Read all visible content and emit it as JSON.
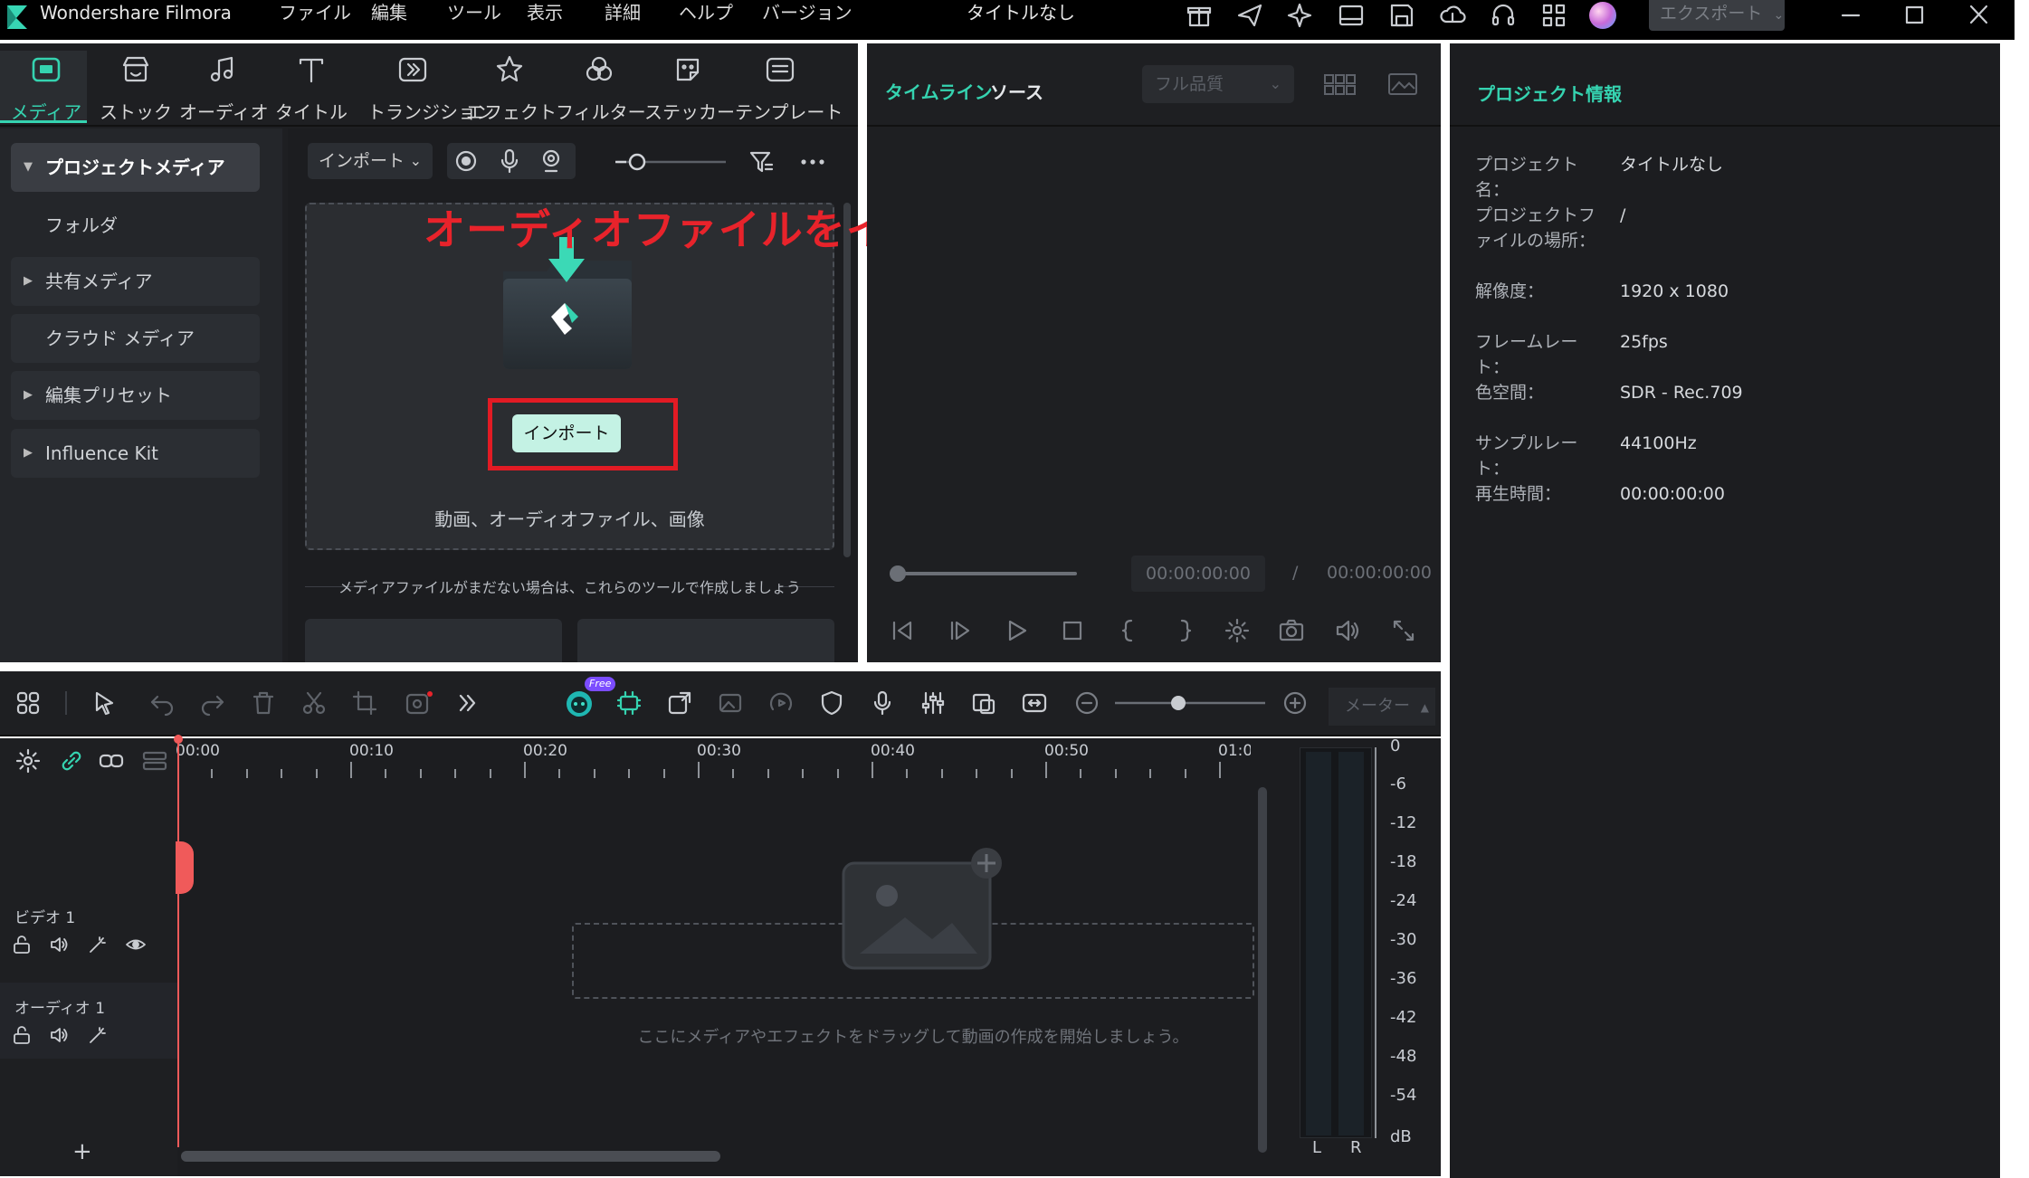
{
  "app": {
    "name": "Wondershare Filmora",
    "menu": [
      "ファイル",
      "編集",
      "ツール",
      "表示",
      "詳細",
      "ヘルプ",
      "バージョン"
    ],
    "project_title": "タイトルなし",
    "export_label": "エクスポート"
  },
  "toolbar": {
    "items": [
      {
        "label": "メディア",
        "icon": "media-icon"
      },
      {
        "label": "ストック",
        "icon": "stock-icon"
      },
      {
        "label": "オーディオ",
        "icon": "audio-icon"
      },
      {
        "label": "タイトル",
        "icon": "title-icon"
      },
      {
        "label": "トランジション",
        "icon": "transition-icon"
      },
      {
        "label": "エフェクト",
        "icon": "effect-icon"
      },
      {
        "label": "フィルター",
        "icon": "filter-icon"
      },
      {
        "label": "ステッカー",
        "icon": "sticker-icon"
      },
      {
        "label": "テンプレート",
        "icon": "template-icon"
      }
    ]
  },
  "sidebar": {
    "items": [
      {
        "label": "プロジェクトメディア"
      },
      {
        "label": "フォルダ"
      },
      {
        "label": "共有メディア"
      },
      {
        "label": "クラウド メディア"
      },
      {
        "label": "編集プリセット"
      },
      {
        "label": "Influence Kit"
      }
    ]
  },
  "media": {
    "import_dropdown": "インポート",
    "import_button": "インポート",
    "drop_caption": "動画、オーディオファイル、画像",
    "tools_hint": "メディアファイルがまだない場合は、これらのツールで作成しましょう",
    "annotation": "オーディオファイルをインポートしてください"
  },
  "player": {
    "tabs": [
      "タイムライン",
      "ソース"
    ],
    "quality": "フル品質",
    "current_time": "00:00:00:00",
    "separator": "/",
    "total_time": "00:00:00:00"
  },
  "project_info": {
    "title": "プロジェクト情報",
    "rows": [
      {
        "key": "プロジェクト名：",
        "value": "タイトルなし"
      },
      {
        "key": "プロジェクトファイルの場所：",
        "value": "/"
      },
      {
        "key": "解像度：",
        "value": "1920 x 1080"
      },
      {
        "key": "フレームレート：",
        "value": "25fps"
      },
      {
        "key": "色空間：",
        "value": "SDR - Rec.709"
      },
      {
        "key": "サンプルレート：",
        "value": "44100Hz"
      },
      {
        "key": "再生時間：",
        "value": "00:00:00:00"
      }
    ]
  },
  "timeline": {
    "badge": "Free",
    "meter_label": "メーター",
    "ticks": [
      "00:00",
      "00:10",
      "00:20",
      "00:30",
      "00:40",
      "00:50",
      "01:0("
    ],
    "tracks": [
      {
        "label": "ビデオ 1"
      },
      {
        "label": "オーディオ 1"
      }
    ],
    "drop_hint": "ここにメディアやエフェクトをドラッグして動画の作成を開始しましょう。",
    "add_track": "+",
    "db_scale": [
      "0",
      "-6",
      "-12",
      "-18",
      "-24",
      "-30",
      "-36",
      "-42",
      "-48",
      "-54",
      "dB"
    ],
    "channels": [
      "L",
      "R"
    ]
  },
  "colors": {
    "accent": "#35d3b0",
    "annotation_red": "#e8232b",
    "playhead": "#f05a5a"
  }
}
